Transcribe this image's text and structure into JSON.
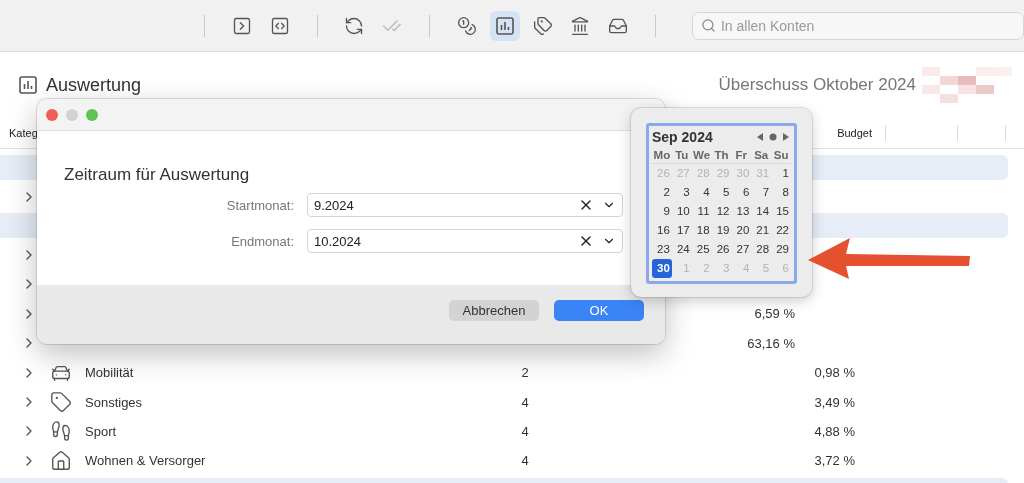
{
  "toolbar": {
    "buttons": [
      {
        "selected": false,
        "disabled": false
      },
      {
        "selected": false,
        "disabled": false
      },
      {
        "selected": false,
        "disabled": false
      },
      {
        "selected": false,
        "disabled": true
      },
      {
        "selected": false,
        "disabled": false
      },
      {
        "selected": true,
        "disabled": false
      },
      {
        "selected": false,
        "disabled": false
      },
      {
        "selected": false,
        "disabled": false
      },
      {
        "selected": false,
        "disabled": false
      }
    ],
    "search": {
      "placeholder": "In allen Konten"
    }
  },
  "header": {
    "title": "Auswertung",
    "summary": "Überschuss Oktober 2024"
  },
  "table": {
    "columns": [
      "Kateg",
      "Budget"
    ],
    "rows": [
      {
        "kind": "group"
      },
      {
        "kind": "row",
        "expanded": false
      },
      {
        "kind": "group"
      },
      {
        "kind": "row",
        "expanded": false
      },
      {
        "kind": "row",
        "expanded": false
      },
      {
        "kind": "row",
        "expanded": false,
        "percent": "6,59 %"
      },
      {
        "kind": "row",
        "expanded": false,
        "percent": "63,16 %"
      },
      {
        "kind": "row",
        "expanded": false,
        "name": "Mobilität",
        "count": "2",
        "percent": "0,98 %"
      },
      {
        "kind": "row",
        "expanded": false,
        "name": "Sonstiges",
        "count": "4",
        "percent": "3,49 %"
      },
      {
        "kind": "row",
        "expanded": false,
        "name": "Sport",
        "count": "4",
        "percent": "4,88 %"
      },
      {
        "kind": "row",
        "expanded": false,
        "name": "Wohnen & Versorger",
        "count": "4",
        "percent": "3,72 %"
      },
      {
        "kind": "group"
      }
    ]
  },
  "dialog": {
    "heading": "Zeitraum für Auswertung",
    "fields": [
      {
        "label": "Startmonat:",
        "value": "9.2024"
      },
      {
        "label": "Endmonat:",
        "value": "10.2024"
      }
    ],
    "buttons": [
      {
        "label": "Abbrechen",
        "default": false
      },
      {
        "label": "OK",
        "default": true
      }
    ]
  },
  "calendar": {
    "month": "Sep 2024",
    "weekdays": [
      "Mo",
      "Tu",
      "We",
      "Th",
      "Fr",
      "Sa",
      "Su"
    ],
    "weeks": [
      [
        {
          "label": "26",
          "muted": true,
          "selected": false
        },
        {
          "label": "27",
          "muted": true,
          "selected": false
        },
        {
          "label": "28",
          "muted": true,
          "selected": false
        },
        {
          "label": "29",
          "muted": true,
          "selected": false
        },
        {
          "label": "30",
          "muted": true,
          "selected": false
        },
        {
          "label": "31",
          "muted": true,
          "selected": false
        },
        {
          "label": "1",
          "muted": false,
          "selected": false
        }
      ],
      [
        {
          "label": "2",
          "muted": false,
          "selected": false
        },
        {
          "label": "3",
          "muted": false,
          "selected": false
        },
        {
          "label": "4",
          "muted": false,
          "selected": false
        },
        {
          "label": "5",
          "muted": false,
          "selected": false
        },
        {
          "label": "6",
          "muted": false,
          "selected": false
        },
        {
          "label": "7",
          "muted": false,
          "selected": false
        },
        {
          "label": "8",
          "muted": false,
          "selected": false
        }
      ],
      [
        {
          "label": "9",
          "muted": false,
          "selected": false
        },
        {
          "label": "10",
          "muted": false,
          "selected": false
        },
        {
          "label": "11",
          "muted": false,
          "selected": false
        },
        {
          "label": "12",
          "muted": false,
          "selected": false
        },
        {
          "label": "13",
          "muted": false,
          "selected": false
        },
        {
          "label": "14",
          "muted": false,
          "selected": false
        },
        {
          "label": "15",
          "muted": false,
          "selected": false
        }
      ],
      [
        {
          "label": "16",
          "muted": false,
          "selected": false
        },
        {
          "label": "17",
          "muted": false,
          "selected": false
        },
        {
          "label": "18",
          "muted": false,
          "selected": false
        },
        {
          "label": "19",
          "muted": false,
          "selected": false
        },
        {
          "label": "20",
          "muted": false,
          "selected": false
        },
        {
          "label": "21",
          "muted": false,
          "selected": false
        },
        {
          "label": "22",
          "muted": false,
          "selected": false
        }
      ],
      [
        {
          "label": "23",
          "muted": false,
          "selected": false
        },
        {
          "label": "24",
          "muted": false,
          "selected": false
        },
        {
          "label": "25",
          "muted": false,
          "selected": false
        },
        {
          "label": "26",
          "muted": false,
          "selected": false
        },
        {
          "label": "27",
          "muted": false,
          "selected": false
        },
        {
          "label": "28",
          "muted": false,
          "selected": false
        },
        {
          "label": "29",
          "muted": false,
          "selected": false
        }
      ],
      [
        {
          "label": "30",
          "muted": false,
          "selected": true
        },
        {
          "label": "1",
          "muted": true,
          "selected": false
        },
        {
          "label": "2",
          "muted": true,
          "selected": false
        },
        {
          "label": "3",
          "muted": true,
          "selected": false
        },
        {
          "label": "4",
          "muted": true,
          "selected": false
        },
        {
          "label": "5",
          "muted": true,
          "selected": false
        },
        {
          "label": "6",
          "muted": true,
          "selected": false
        }
      ]
    ]
  }
}
